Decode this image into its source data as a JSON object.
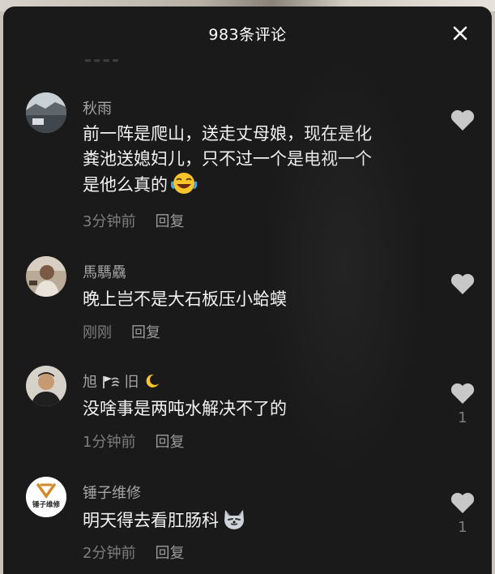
{
  "header": {
    "title": "983条评论"
  },
  "comments": [
    {
      "username": "秋雨",
      "lines": [
        "前一阵是爬山，送走丈母娘，现在是化",
        "粪池送媳妇儿，只不过一个是电视一个",
        "是他么真的"
      ],
      "emoji": "laughing-emoji-icon",
      "time": "3分钟前",
      "reply": "回复",
      "likes": ""
    },
    {
      "username": "馬騳驫",
      "lines": [
        "晚上岂不是大石板压小蛤蟆"
      ],
      "time": "刚刚",
      "reply": "回复",
      "likes": ""
    },
    {
      "username": "旭",
      "username_suffix": "旧",
      "username_icons": [
        "flag-icon",
        "crescent-moon-icon"
      ],
      "lines": [
        "没啥事是两吨水解决不了的"
      ],
      "time": "1分钟前",
      "reply": "回复",
      "likes": "1"
    },
    {
      "username": "锤子维修",
      "avatar_text": "锤子维修",
      "lines": [
        "明天得去看肛肠科"
      ],
      "emoji": "wolf-emoji-icon",
      "time": "2分钟前",
      "reply": "回复",
      "likes": "1"
    }
  ],
  "colors": {
    "sheet": "#1a1a1a",
    "text": "#f2f2f2",
    "meta": "#7d7d7d",
    "heart": "#c8c8c8"
  }
}
